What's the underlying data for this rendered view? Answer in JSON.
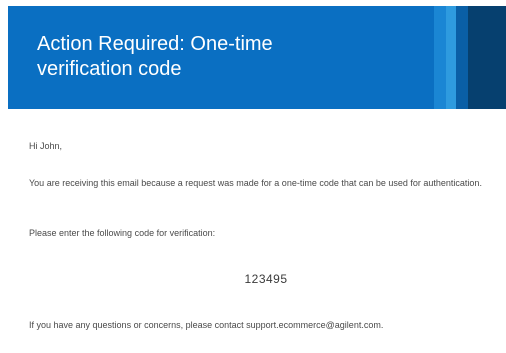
{
  "header": {
    "title_line1": "Action Required: One-time",
    "title_line2": "verification code",
    "accent_color": "#0a6fc2"
  },
  "body": {
    "greeting": "Hi John,",
    "paragraph1": "You are receiving this email because a request was made for a one-time code that can be used for authentication.",
    "paragraph2": "Please enter the following code for verification:",
    "code": "123495",
    "paragraph3": "If you have any questions or concerns, please contact support.ecommerce@agilent.com."
  }
}
